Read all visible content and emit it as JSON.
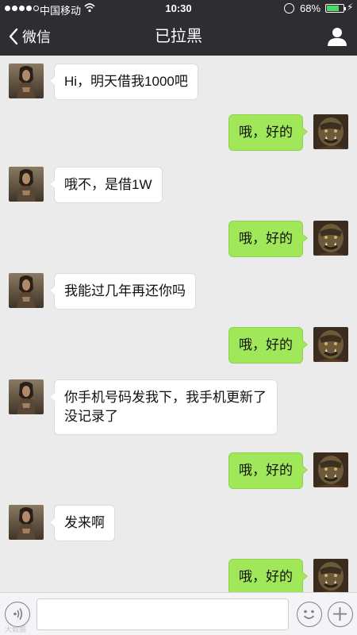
{
  "status_bar": {
    "carrier": "中国移动",
    "time": "10:30",
    "battery_percent": "68%",
    "battery_level": 0.68,
    "signal_bars_filled": 4,
    "signal_bars_total": 5
  },
  "nav": {
    "back_label": "微信",
    "title": "已拉黑"
  },
  "messages": [
    {
      "side": "in",
      "text": "Hi，明天借我1000吧"
    },
    {
      "side": "out",
      "text": "哦，好的"
    },
    {
      "side": "in",
      "text": "哦不，是借1W"
    },
    {
      "side": "out",
      "text": "哦，好的"
    },
    {
      "side": "in",
      "text": "我能过几年再还你吗"
    },
    {
      "side": "out",
      "text": "哦，好的"
    },
    {
      "side": "in",
      "text": "你手机号码发我下，我手机更新了没记录了"
    },
    {
      "side": "out",
      "text": "哦，好的"
    },
    {
      "side": "in",
      "text": "发来啊"
    },
    {
      "side": "out",
      "text": "哦，好的"
    }
  ],
  "input_bar": {
    "placeholder": ""
  },
  "watermark": "大数据",
  "colors": {
    "header_bg": "#2e2e32",
    "chat_bg": "#ebebeb",
    "outgoing_bubble": "#a0e75a",
    "incoming_bubble": "#ffffff",
    "battery_fill": "#4cd964"
  },
  "icons": {
    "back": "chevron-left-icon",
    "profile": "person-icon",
    "voice": "voice-icon",
    "emoji": "emoji-icon",
    "more": "plus-icon",
    "wifi": "wifi-icon",
    "lock": "rotation-lock-icon",
    "charge": "charging-icon"
  }
}
